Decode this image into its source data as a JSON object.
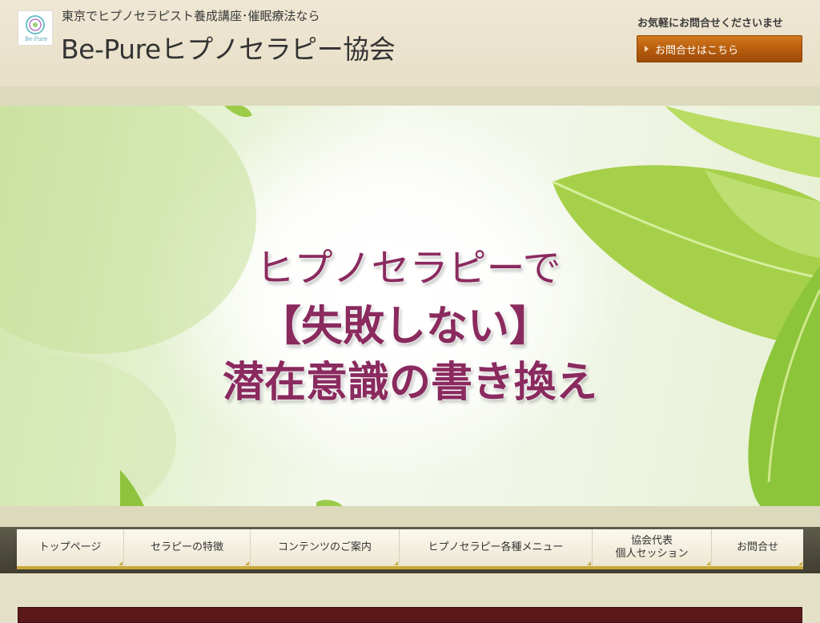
{
  "header": {
    "logo_text": "Be-Pure",
    "tagline": "東京でヒプノセラピスト養成講座･催眠療法なら",
    "site_title": "Be-Pureヒプノセラピー協会",
    "contact_note": "お気軽にお問合せくださいませ",
    "contact_button": "お問合せはこちら"
  },
  "hero": {
    "line1": "ヒプノセラピーで",
    "line2": "【失敗しない】",
    "line3": "潜在意識の書き換え"
  },
  "nav": {
    "items": [
      {
        "label": "トップページ"
      },
      {
        "label": "セラピーの特徴"
      },
      {
        "label": "コンテンツのご案内"
      },
      {
        "label": "ヒプノセラピー各種メニュー"
      },
      {
        "label": "協会代表\n個人セッション"
      },
      {
        "label": "お問合せ"
      }
    ]
  },
  "colors": {
    "accent_orange": "#b55b0c",
    "hero_text": "#8a2a5e",
    "nav_underline": "#c8a93a"
  }
}
